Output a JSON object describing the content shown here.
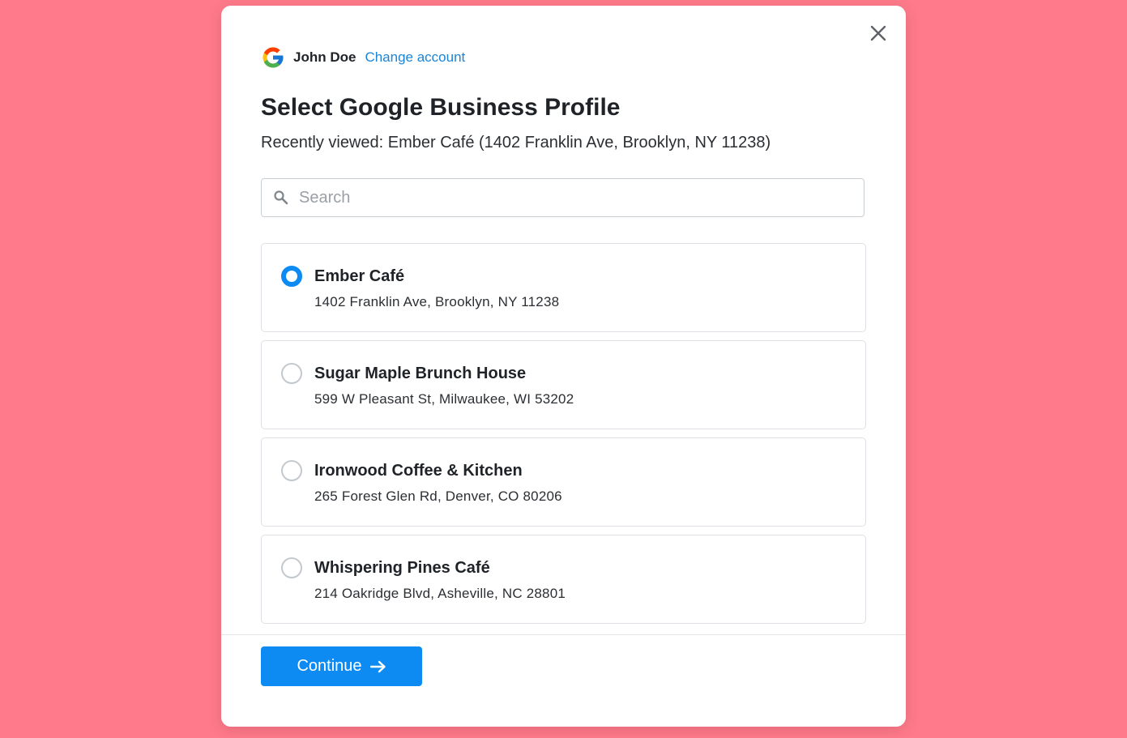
{
  "account": {
    "name": "John Doe",
    "change_label": "Change account"
  },
  "dialog": {
    "title": "Select Google Business Profile",
    "subtitle": "Recently viewed: Ember Café (1402 Franklin Ave, Brooklyn, NY 11238)"
  },
  "search": {
    "value": "",
    "placeholder": "Search"
  },
  "profiles": [
    {
      "name": "Ember Café",
      "address": "1402 Franklin Ave, Brooklyn, NY 11238",
      "selected": true
    },
    {
      "name": "Sugar Maple Brunch House",
      "address": "599 W Pleasant St, Milwaukee, WI 53202",
      "selected": false
    },
    {
      "name": "Ironwood Coffee & Kitchen",
      "address": "265 Forest Glen Rd, Denver, CO 80206",
      "selected": false
    },
    {
      "name": "Whispering Pines Café",
      "address": "214 Oakridge Blvd, Asheville, NC 28801",
      "selected": false
    }
  ],
  "footer": {
    "continue_label": "Continue"
  },
  "icons": {
    "close": "close-icon",
    "google": "google-logo-icon",
    "search": "search-icon",
    "arrow": "arrow-right-icon"
  },
  "colors": {
    "background": "#ff7a8a",
    "accent": "#0d8bf2",
    "link": "#1c84d6"
  }
}
